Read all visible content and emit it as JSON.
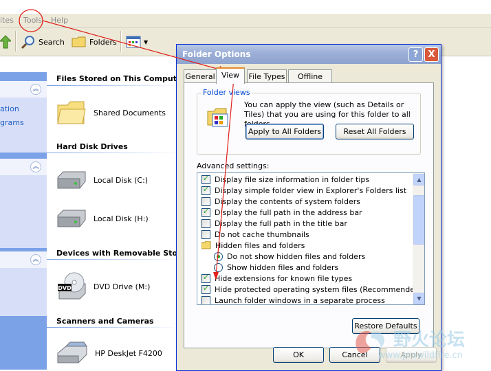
{
  "menu": {
    "favorites_partial": "ites",
    "tools": "Tools",
    "help": "Help"
  },
  "toolbar": {
    "search": "Search",
    "folders": "Folders"
  },
  "taskpane": {
    "line1": "ation",
    "line2": "grams"
  },
  "sections": {
    "files_stored": "Files Stored on This Computer",
    "hard_disk": "Hard Disk Drives",
    "removable": "Devices with Removable Storag",
    "scanners": "Scanners and Cameras"
  },
  "items": {
    "shared_documents": "Shared Documents",
    "local_disk_c": "Local Disk (C:)",
    "local_disk_h": "Local Disk (H:)",
    "dvd_drive": "DVD Drive (M:)",
    "dvd_badge": "DVD",
    "printer": "HP DeskJet F4200"
  },
  "dialog": {
    "title": "Folder Options",
    "help_btn": "?",
    "close_btn": "X",
    "tabs": [
      "General",
      "View",
      "File Types",
      "Offline Files"
    ],
    "folder_views_label": "Folder views",
    "folder_views_desc": "You can apply the view (such as Details or Tiles) that you are using for this folder to all folders.",
    "apply_all": "Apply to All Folders",
    "reset_all": "Reset All Folders",
    "advanced_label": "Advanced settings:",
    "settings": [
      {
        "text": "Display file size information in folder tips",
        "type": "check",
        "on": true
      },
      {
        "text": "Display simple folder view in Explorer's Folders list",
        "type": "check",
        "on": true
      },
      {
        "text": "Display the contents of system folders",
        "type": "check",
        "on": false
      },
      {
        "text": "Display the full path in the address bar",
        "type": "check",
        "on": true
      },
      {
        "text": "Display the full path in the title bar",
        "type": "check",
        "on": false
      },
      {
        "text": "Do not cache thumbnails",
        "type": "check",
        "on": false
      },
      {
        "text": "Hidden files and folders",
        "type": "folder",
        "on": false
      },
      {
        "text": "Do not show hidden files and folders",
        "type": "radio",
        "on": true
      },
      {
        "text": "Show hidden files and folders",
        "type": "radio",
        "on": false
      },
      {
        "text": "Hide extensions for known file types",
        "type": "check",
        "on": true
      },
      {
        "text": "Hide protected operating system files (Recommended)",
        "type": "check",
        "on": true
      },
      {
        "text": "Launch folder windows in a separate process",
        "type": "check",
        "on": false
      }
    ],
    "restore_defaults": "Restore Defaults",
    "ok": "OK",
    "cancel": "Cancel",
    "apply": "Apply"
  },
  "watermark": {
    "cn": "野火论坛",
    "url": "www.prowildfire.cn"
  },
  "colors": {
    "annotation": "#E0201A",
    "dialog_border": "#0831D9",
    "taskpane": "#7BA2E7"
  }
}
